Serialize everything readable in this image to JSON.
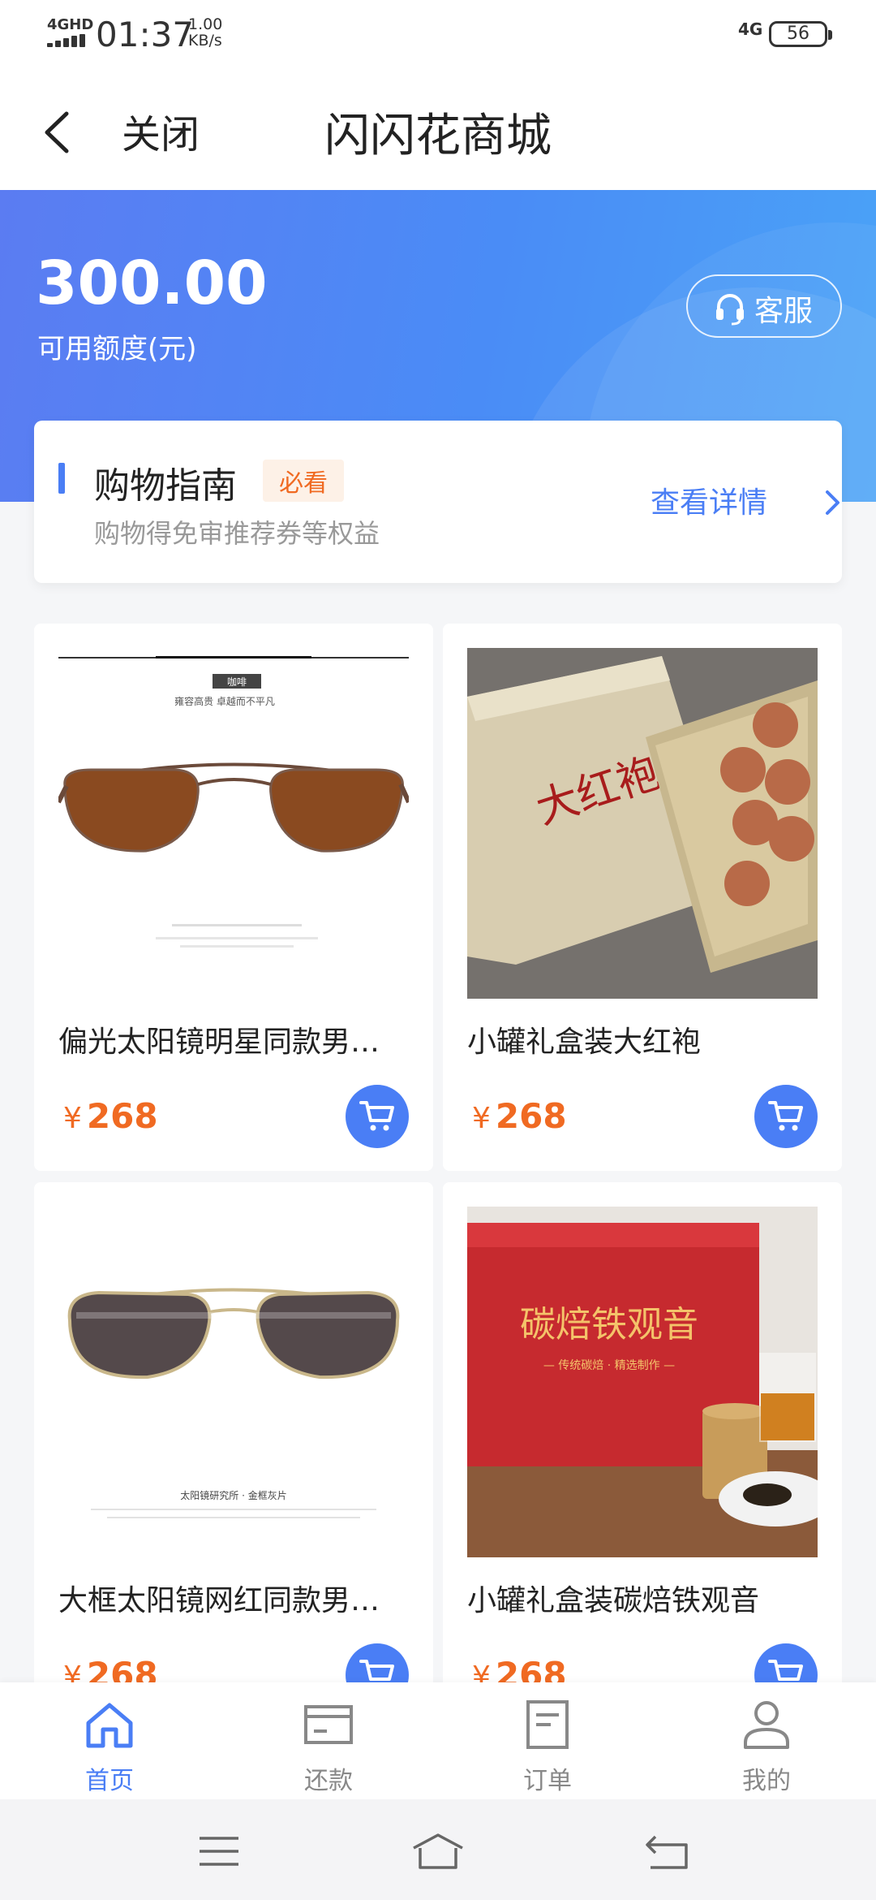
{
  "status_bar": {
    "network_type": "4GHD",
    "time": "01:37",
    "speed_value": "1.00",
    "speed_unit": "KB/s",
    "right_network": "4G",
    "battery": "56"
  },
  "title_bar": {
    "close_label": "关闭",
    "title": "闪闪花商城"
  },
  "hero": {
    "amount": "300.00",
    "amount_label": "可用额度(元)",
    "customer_service_label": "客服"
  },
  "guide": {
    "title": "购物指南",
    "badge": "必看",
    "subtitle": "购物得免审推荐券等权益",
    "detail_link": "查看详情"
  },
  "products": [
    {
      "name": "偏光太阳镜明星同款男士…",
      "currency": "¥",
      "price": "268",
      "image_text": "咖啡",
      "image_caption": "雍容高贵 卓越而不平凡"
    },
    {
      "name": "小罐礼盒装大红袍",
      "currency": "¥",
      "price": "268",
      "image_text": "大红袍"
    },
    {
      "name": "大框太阳镜网红同款男士…",
      "currency": "¥",
      "price": "268",
      "image_caption": "太阳镜研究所 · 金框灰片"
    },
    {
      "name": "小罐礼盒装碳焙铁观音",
      "currency": "¥",
      "price": "268",
      "image_text": "碳焙铁观音",
      "image_caption": "— 传统碳焙 · 精选制作 —"
    }
  ],
  "tabs": [
    {
      "label": "首页",
      "icon": "home-icon",
      "active": true
    },
    {
      "label": "还款",
      "icon": "card-icon",
      "active": false
    },
    {
      "label": "订单",
      "icon": "order-icon",
      "active": false
    },
    {
      "label": "我的",
      "icon": "profile-icon",
      "active": false
    }
  ],
  "colors": {
    "accent": "#4a7ef5",
    "price": "#f06a22",
    "hero_start": "#5b7cf2",
    "hero_end": "#4aa3f7"
  }
}
